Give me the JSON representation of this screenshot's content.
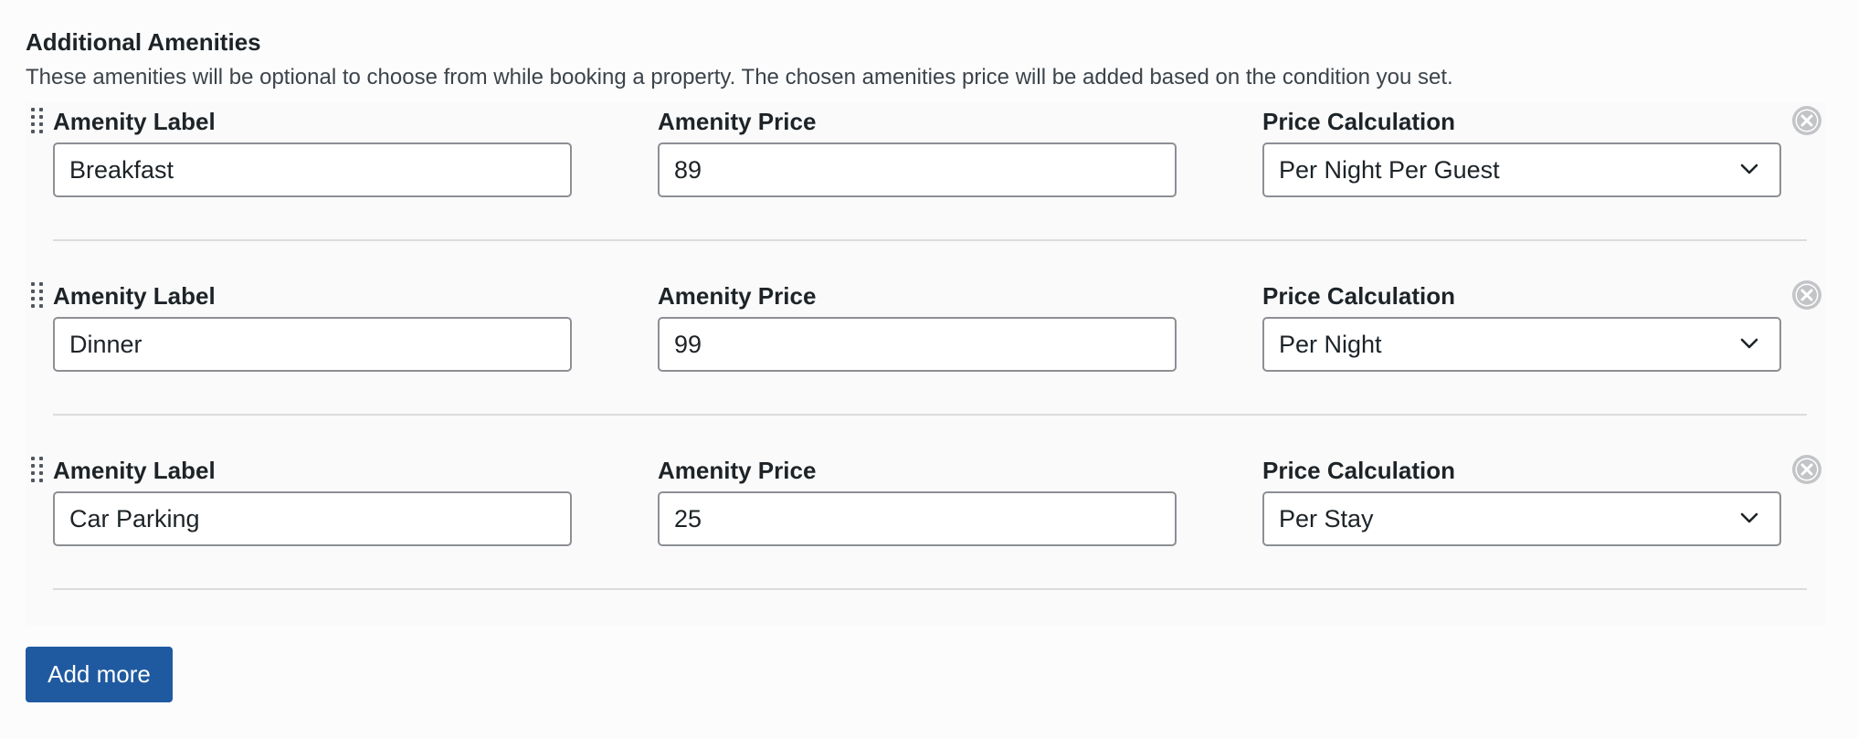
{
  "section": {
    "title": "Additional Amenities",
    "description": "These amenities will be optional to choose from while booking a property. The chosen amenities price will be added based on the condition you set."
  },
  "labels": {
    "amenity_label": "Amenity Label",
    "amenity_price": "Amenity Price",
    "price_calculation": "Price Calculation"
  },
  "amenities": [
    {
      "label": "Breakfast",
      "price": "89",
      "calculation": "Per Night Per Guest"
    },
    {
      "label": "Dinner",
      "price": "99",
      "calculation": "Per Night"
    },
    {
      "label": "Car Parking",
      "price": "25",
      "calculation": "Per Stay"
    }
  ],
  "icons": {
    "drag": "drag-handle-icon",
    "remove": "remove-circle-x-icon",
    "select_arrow": "chevron-down-icon"
  },
  "colors": {
    "accent": "#1f5aa0",
    "remove_icon": "#c3c4c7",
    "border": "#8c8f94"
  },
  "actions": {
    "add_more_label": "Add more"
  }
}
